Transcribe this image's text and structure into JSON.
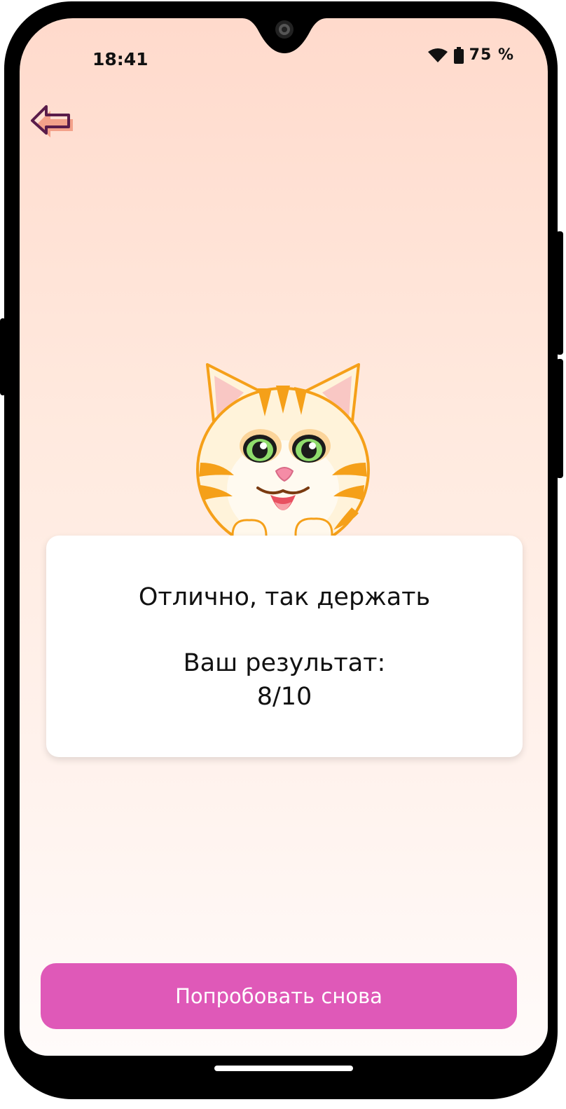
{
  "status_bar": {
    "time": "18:41",
    "battery_percent": "75 %"
  },
  "result": {
    "message": "Отлично, так держать",
    "score_label": "Ваш результат:",
    "score_value": "8/10"
  },
  "actions": {
    "retry_label": "Попробовать снова"
  },
  "icons": {
    "back": "back-arrow-icon",
    "wifi": "wifi-icon",
    "battery": "battery-icon",
    "mascot": "cat-mascot"
  },
  "colors": {
    "accent": "#df59b8",
    "back_icon": "#5a1c4a",
    "cat_orange": "#f5a019",
    "bg_top": "#ffdacc",
    "bg_bottom": "#fffbfa"
  }
}
